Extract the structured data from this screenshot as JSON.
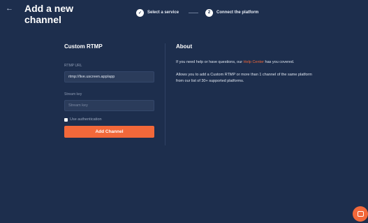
{
  "header": {
    "back_icon": "arrow-left-icon",
    "title": "Add a new channel"
  },
  "steps": [
    {
      "label": "Select a service",
      "status": "done",
      "icon": "check-icon"
    },
    {
      "label": "Connect the platform",
      "status": "current",
      "number": "2"
    }
  ],
  "form": {
    "section_title": "Custom RTMP",
    "rtmp_url_label": "RTMP URL",
    "rtmp_url_value": "rtmp://live.uscreen.app/app",
    "stream_key_label": "Stream key",
    "stream_key_placeholder": "Stream key",
    "auth_label": "Use authentication",
    "add_button_label": "Add Channel"
  },
  "about": {
    "title": "About",
    "p1_before": "If you need help or have questions, our ",
    "p1_link": "Help Center",
    "p1_after": " has you covered.",
    "p2": "Allows you to add a Custom RTMP or more than 1 channel of the same platform from our list of 30+ supported platforms."
  },
  "colors": {
    "background": "#1d2e4d",
    "accent": "#f2683a"
  }
}
